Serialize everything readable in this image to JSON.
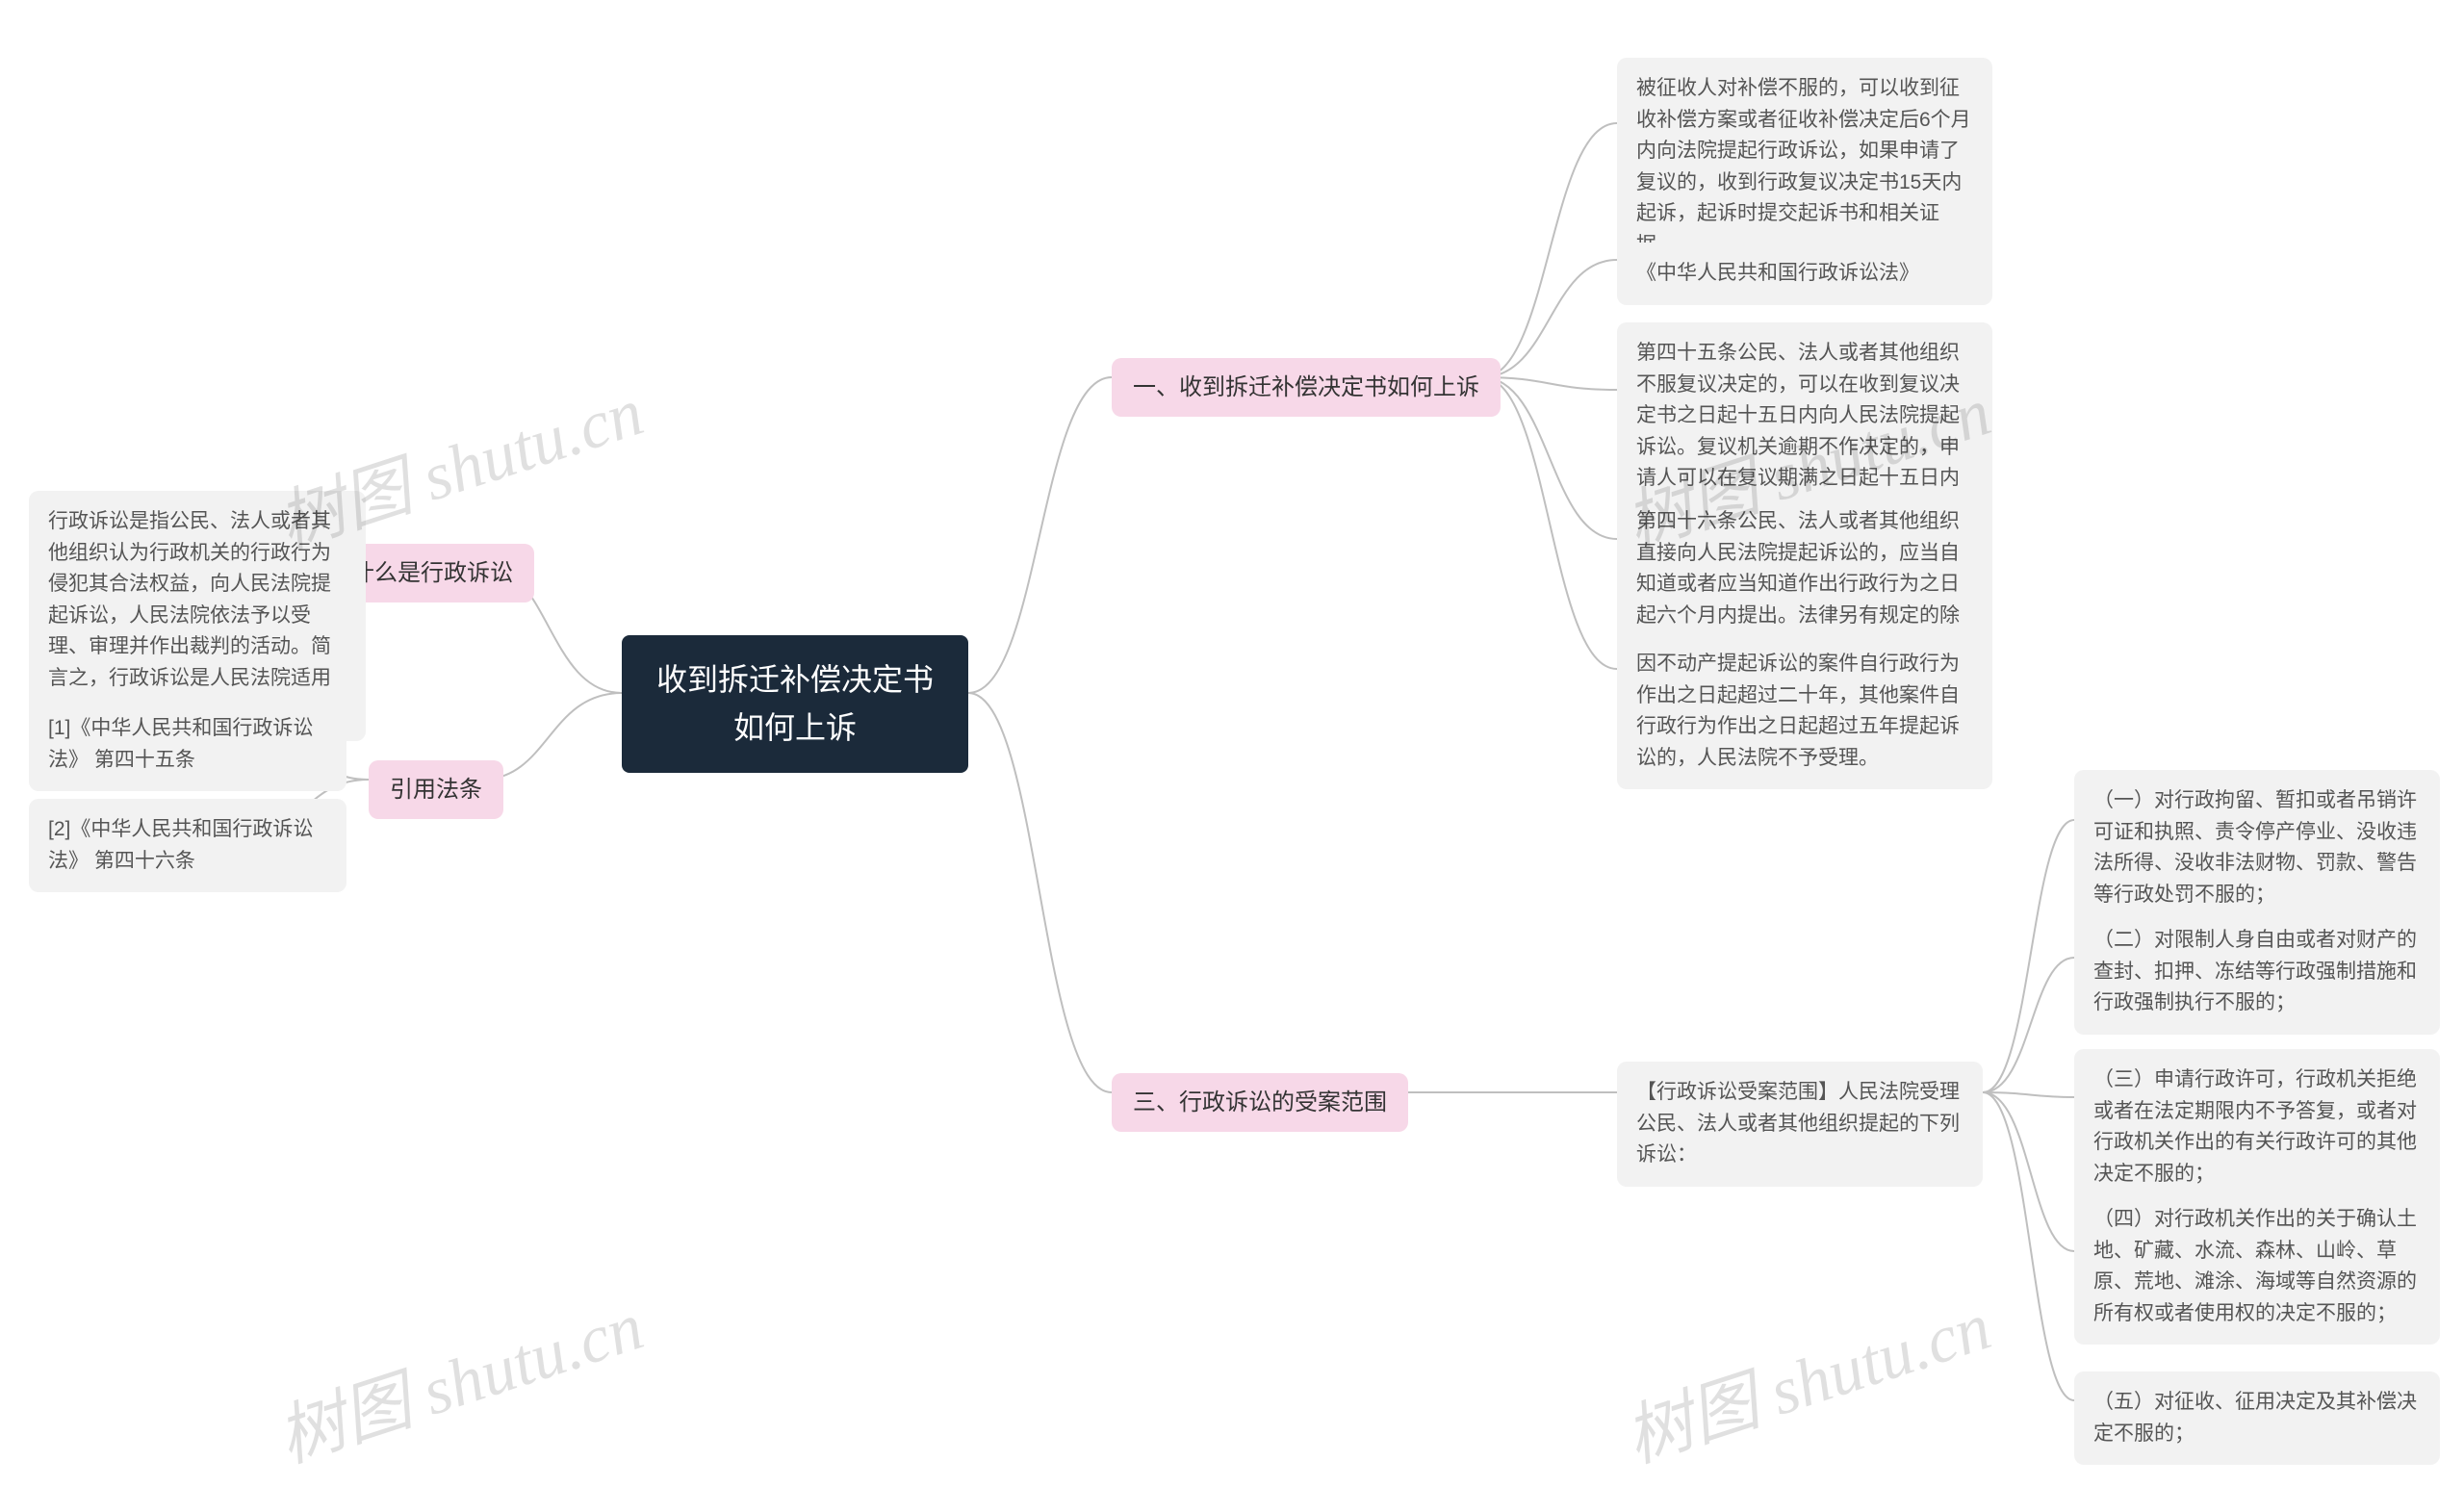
{
  "root": "收到拆迁补偿决定书如何上诉",
  "branches": {
    "b1": {
      "label": "一、收到拆迁补偿决定书如何上诉"
    },
    "b2": {
      "label": "二、什么是行政诉讼"
    },
    "b3": {
      "label": "三、行政诉讼的受案范围"
    },
    "b4": {
      "label": "引用法条"
    }
  },
  "b1_children": {
    "c1": "被征收人对补偿不服的，可以收到征收补偿方案或者征收补偿决定后6个月内向法院提起行政诉讼，如果申请了复议的，收到行政复议决定书15天内起诉，起诉时提交起诉书和相关证据。",
    "c2": "《中华人民共和国行政诉讼法》",
    "c3": "第四十五条公民、法人或者其他组织不服复议决定的，可以在收到复议决定书之日起十五日内向人民法院提起诉讼。复议机关逾期不作决定的，申请人可以在复议期满之日起十五日内向人民法院提起诉讼。法律另有规定的除外。",
    "c4": "第四十六条公民、法人或者其他组织直接向人民法院提起诉讼的，应当自知道或者应当知道作出行政行为之日起六个月内提出。法律另有规定的除外。",
    "c5": "因不动产提起诉讼的案件自行政行为作出之日起超过二十年，其他案件自行政行为作出之日起超过五年提起诉讼的，人民法院不予受理。"
  },
  "b2_children": {
    "c1": "行政诉讼是指公民、法人或者其他组织认为行政机关的行政行为侵犯其合法权益，向人民法院提起诉讼，人民法院依法予以受理、审理并作出裁判的活动。简言之，行政诉讼是人民法院适用司法程序解决行政争议的活动。"
  },
  "b3_children": {
    "intro": "【行政诉讼受案范围】人民法院受理公民、法人或者其他组织提起的下列诉讼：",
    "c1": "（一）对行政拘留、暂扣或者吊销许可证和执照、责令停产停业、没收违法所得、没收非法财物、罚款、警告等行政处罚不服的；",
    "c2": "（二）对限制人身自由或者对财产的查封、扣押、冻结等行政强制措施和行政强制执行不服的；",
    "c3": "（三）申请行政许可，行政机关拒绝或者在法定期限内不予答复，或者对行政机关作出的有关行政许可的其他决定不服的；",
    "c4": "（四）对行政机关作出的关于确认土地、矿藏、水流、森林、山岭、草原、荒地、滩涂、海域等自然资源的所有权或者使用权的决定不服的；",
    "c5": "（五）对征收、征用决定及其补偿决定不服的；"
  },
  "b4_children": {
    "c1": "[1]《中华人民共和国行政诉讼法》 第四十五条",
    "c2": "[2]《中华人民共和国行政诉讼法》 第四十六条"
  },
  "watermark": "树图 shutu.cn"
}
